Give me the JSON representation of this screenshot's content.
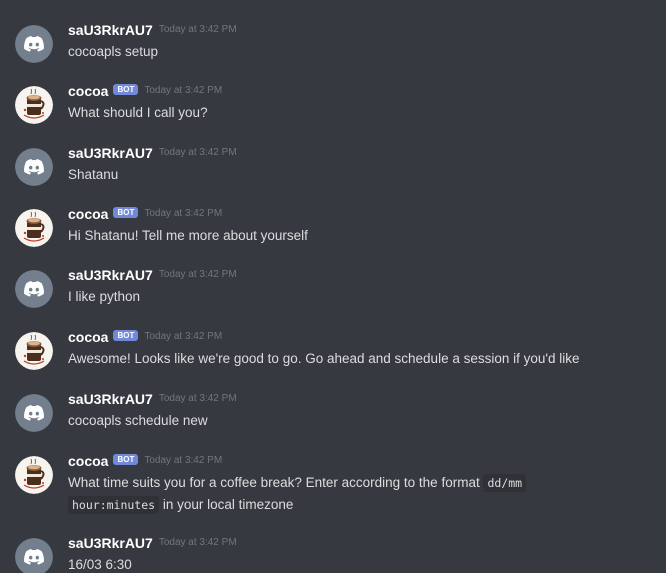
{
  "users": {
    "human": "saU3RkrAU7",
    "bot": "cocoa",
    "bot_tag": "BOT"
  },
  "colors": {
    "background": "#36393f",
    "discord_avatar_bg": "#747f8d",
    "bot_tag": "#7289da",
    "username": "#ffffff",
    "message_text": "#dcddde",
    "timestamp": "#72767d"
  },
  "messages": [
    {
      "author": "saU3RkrAU7",
      "avatar": "discord-logo-icon",
      "bot": false,
      "timestamp": "Today at 3:42 PM",
      "text": "cocoapls setup"
    },
    {
      "author": "cocoa",
      "avatar": "coffee-cup-avatar-icon",
      "bot": true,
      "timestamp": "Today at 3:42 PM",
      "text": "What should I call you?"
    },
    {
      "author": "saU3RkrAU7",
      "avatar": "discord-logo-icon",
      "bot": false,
      "timestamp": "Today at 3:42 PM",
      "text": "Shatanu"
    },
    {
      "author": "cocoa",
      "avatar": "coffee-cup-avatar-icon",
      "bot": true,
      "timestamp": "Today at 3:42 PM",
      "text": "Hi Shatanu! Tell me more about yourself"
    },
    {
      "author": "saU3RkrAU7",
      "avatar": "discord-logo-icon",
      "bot": false,
      "timestamp": "Today at 3:42 PM",
      "text": "I like python"
    },
    {
      "author": "cocoa",
      "avatar": "coffee-cup-avatar-icon",
      "bot": true,
      "timestamp": "Today at 3:42 PM",
      "text": "Awesome! Looks like we're good to go. Go ahead and schedule a session if you'd like"
    },
    {
      "author": "saU3RkrAU7",
      "avatar": "discord-logo-icon",
      "bot": false,
      "timestamp": "Today at 3:42 PM",
      "text": "cocoapls schedule new"
    },
    {
      "author": "cocoa",
      "avatar": "coffee-cup-avatar-icon",
      "bot": true,
      "timestamp": "Today at 3:42 PM",
      "text_part1": "What time suits you for a coffee break? Enter according to the format ",
      "code1": "dd/mm",
      "code2": "hour:minutes",
      "text_part2": " in your local timezone"
    },
    {
      "author": "saU3RkrAU7",
      "avatar": "discord-logo-icon",
      "bot": false,
      "timestamp": "Today at 3:42 PM",
      "text": "16/03 6:30"
    }
  ]
}
